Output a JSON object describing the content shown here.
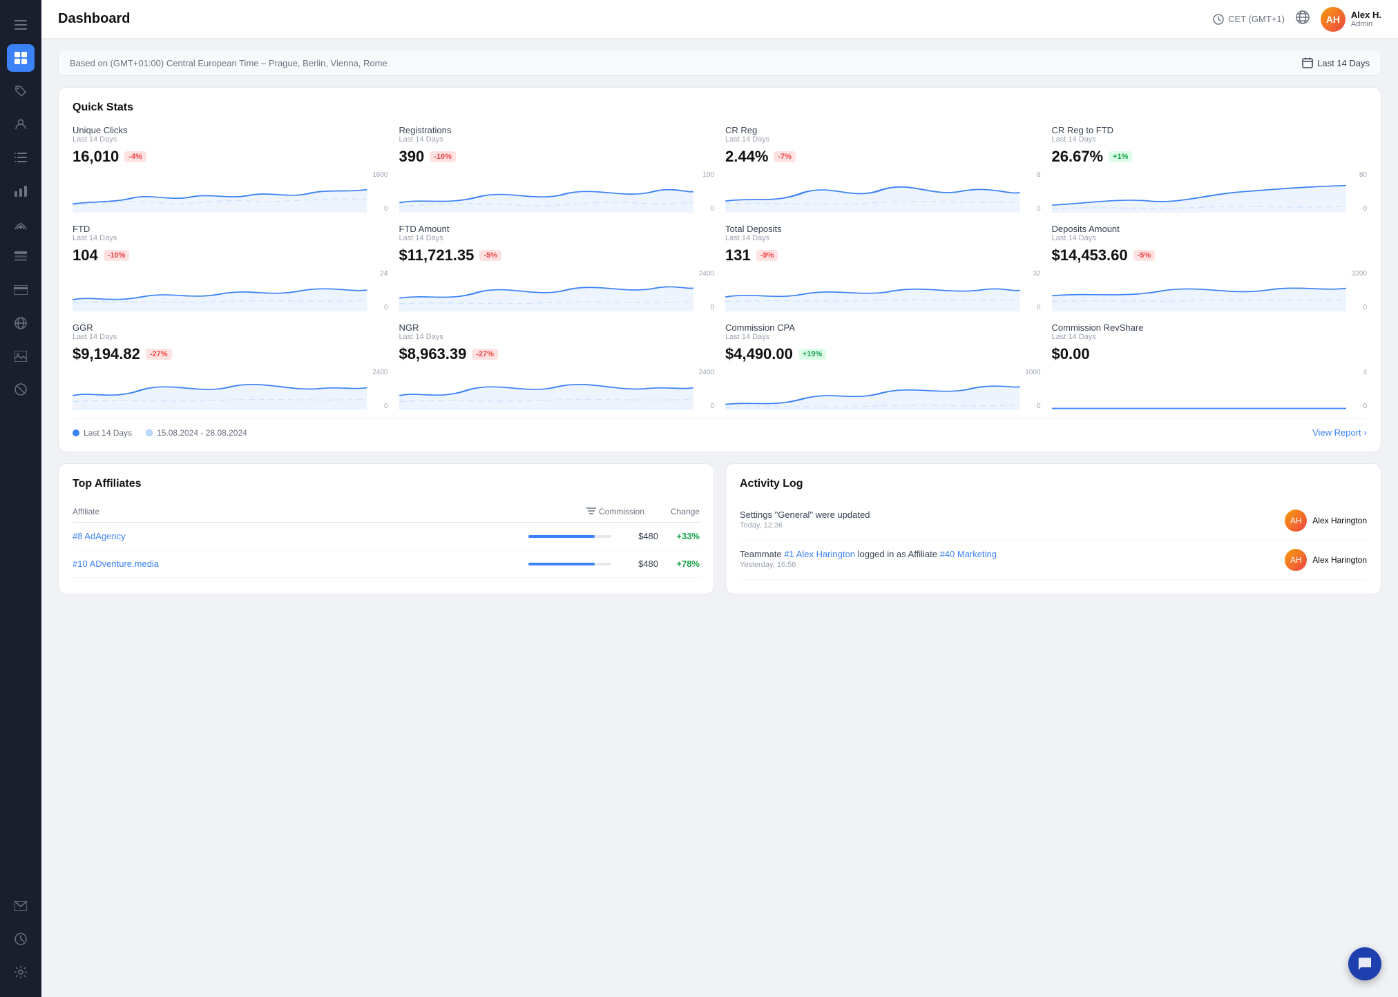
{
  "header": {
    "title": "Dashboard",
    "timezone": "CET (GMT+1)",
    "globe_icon": "🌐",
    "clock_icon": "🕐",
    "user": {
      "name": "Alex H.",
      "role": "Admin",
      "initials": "AH"
    }
  },
  "topbar": {
    "timezone_text": "Based on (GMT+01:00) Central European Time – Prague, Berlin, Vienna, Rome",
    "date_range": "Last 14 Days",
    "calendar_icon": "📅"
  },
  "quick_stats": {
    "title": "Quick Stats",
    "stats": [
      {
        "label": "Unique Clicks",
        "period": "Last 14 Days",
        "value": "16,010",
        "badge": "-4%",
        "badge_type": "red",
        "y_max": "1600",
        "y_min": "0"
      },
      {
        "label": "Registrations",
        "period": "Last 14 Days",
        "value": "390",
        "badge": "-10%",
        "badge_type": "red",
        "y_max": "100",
        "y_min": "0"
      },
      {
        "label": "CR Reg",
        "period": "Last 14 Days",
        "value": "2.44%",
        "badge": "-7%",
        "badge_type": "red",
        "y_max": "8",
        "y_min": "0"
      },
      {
        "label": "CR Reg to FTD",
        "period": "Last 14 Days",
        "value": "26.67%",
        "badge": "+1%",
        "badge_type": "green",
        "y_max": "80",
        "y_min": "0"
      },
      {
        "label": "FTD",
        "period": "Last 14 Days",
        "value": "104",
        "badge": "-10%",
        "badge_type": "red",
        "y_max": "24",
        "y_min": "0"
      },
      {
        "label": "FTD Amount",
        "period": "Last 14 Days",
        "value": "$11,721.35",
        "badge": "-5%",
        "badge_type": "red",
        "y_max": "2400",
        "y_min": "0"
      },
      {
        "label": "Total Deposits",
        "period": "Last 14 Days",
        "value": "131",
        "badge": "-9%",
        "badge_type": "red",
        "y_max": "32",
        "y_min": "0"
      },
      {
        "label": "Deposits Amount",
        "period": "Last 14 Days",
        "value": "$14,453.60",
        "badge": "-5%",
        "badge_type": "red",
        "y_max": "3200",
        "y_min": "0"
      },
      {
        "label": "GGR",
        "period": "Last 14 Days",
        "value": "$9,194.82",
        "badge": "-27%",
        "badge_type": "red",
        "y_max": "2400",
        "y_min": "0"
      },
      {
        "label": "NGR",
        "period": "Last 14 Days",
        "value": "$8,963.39",
        "badge": "-27%",
        "badge_type": "red",
        "y_max": "2400",
        "y_min": "0"
      },
      {
        "label": "Commission CPA",
        "period": "Last 14 Days",
        "value": "$4,490.00",
        "badge": "+19%",
        "badge_type": "green",
        "y_max": "1000",
        "y_min": "0"
      },
      {
        "label": "Commission RevShare",
        "period": "Last 14 Days",
        "value": "$0.00",
        "badge": null,
        "badge_type": null,
        "y_max": "4",
        "y_min": "0"
      }
    ],
    "legend": {
      "item1": "Last 14 Days",
      "item2": "15.08.2024 - 28.08.2024"
    },
    "view_report": "View Report"
  },
  "top_affiliates": {
    "title": "Top Affiliates",
    "columns": {
      "affiliate": "Affiliate",
      "commission": "Commission",
      "change": "Change"
    },
    "rows": [
      {
        "id": "#8",
        "name": "AdAgency",
        "value": "$480",
        "change": "+33%",
        "bar_pct": 80
      },
      {
        "id": "#10",
        "name": "ADventure.media",
        "value": "$480",
        "change": "+78%",
        "bar_pct": 80
      }
    ]
  },
  "activity_log": {
    "title": "Activity Log",
    "items": [
      {
        "text": "Settings \"General\" were updated",
        "time": "Today, 12:36",
        "user": "Alex Harington",
        "initials": "AH"
      },
      {
        "text_parts": {
          "prefix": "Teammate ",
          "link1": "#1 Alex Harington",
          "middle": " logged in as Affiliate ",
          "link2": "#40 Marketing"
        },
        "time": "Yesterday, 16:56",
        "user": "Alex Harington",
        "initials": "AH"
      }
    ]
  },
  "sidebar": {
    "icons": [
      {
        "name": "menu-icon",
        "symbol": "☰",
        "active": false
      },
      {
        "name": "dashboard-icon",
        "symbol": "⊞",
        "active": true
      },
      {
        "name": "tag-icon",
        "symbol": "🏷",
        "active": false
      },
      {
        "name": "user-icon",
        "symbol": "👤",
        "active": false
      },
      {
        "name": "list-icon",
        "symbol": "☰",
        "active": false
      },
      {
        "name": "chart-icon",
        "symbol": "📊",
        "active": false
      },
      {
        "name": "signal-icon",
        "symbol": "📡",
        "active": false
      },
      {
        "name": "table-icon",
        "symbol": "⊟",
        "active": false
      },
      {
        "name": "card-icon",
        "symbol": "💳",
        "active": false
      },
      {
        "name": "globe-icon",
        "symbol": "🌐",
        "active": false
      },
      {
        "name": "image-icon",
        "symbol": "🖼",
        "active": false
      },
      {
        "name": "block-icon",
        "symbol": "⊘",
        "active": false
      },
      {
        "name": "mail-icon",
        "symbol": "✉",
        "active": false
      },
      {
        "name": "history-icon",
        "symbol": "🕐",
        "active": false
      },
      {
        "name": "settings-icon",
        "symbol": "⚙",
        "active": false
      }
    ]
  }
}
